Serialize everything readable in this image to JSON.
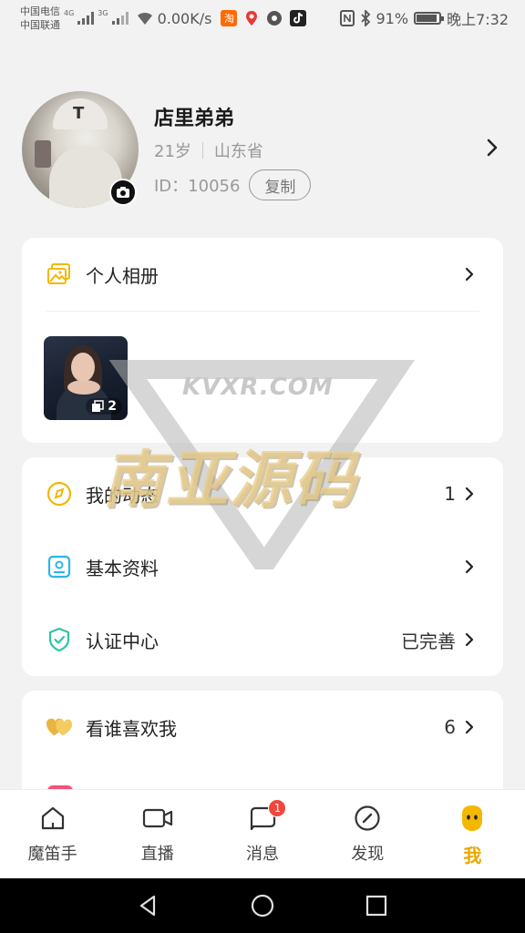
{
  "status_bar": {
    "carrier1": "中国电信",
    "carrier2": "中国联通",
    "net1": "4G",
    "net2": "3G",
    "speed": "0.00K/s",
    "app_taobao": "淘",
    "battery": "91%",
    "battery_level": 0.91,
    "time": "晚上7:32"
  },
  "profile": {
    "name": "店里弟弟",
    "age": "21岁",
    "location": "山东省",
    "id_text": "ID：10056",
    "copy_label": "复制"
  },
  "album": {
    "title": "个人相册",
    "count": "2"
  },
  "menu": [
    {
      "label": "我的动态",
      "value": "1",
      "icon": "compass-circle-icon"
    },
    {
      "label": "基本资料",
      "value": "",
      "icon": "profile-card-icon"
    },
    {
      "label": "认证中心",
      "value": "已完善",
      "icon": "shield-check-icon"
    }
  ],
  "likes": {
    "label": "看谁喜欢我",
    "value": "6"
  },
  "watermark": {
    "url": "KVXR.COM",
    "text": "南亚源码"
  },
  "tabs": [
    {
      "label": "魔笛手",
      "icon": "home-icon"
    },
    {
      "label": "直播",
      "icon": "video-camera-icon"
    },
    {
      "label": "消息",
      "icon": "message-icon",
      "badge": "1"
    },
    {
      "label": "发现",
      "icon": "discover-compass-icon"
    },
    {
      "label": "我",
      "icon": "smiley-face-icon",
      "active": true
    }
  ],
  "colors": {
    "accent": "#e8a800",
    "badge": "#f0463c"
  }
}
